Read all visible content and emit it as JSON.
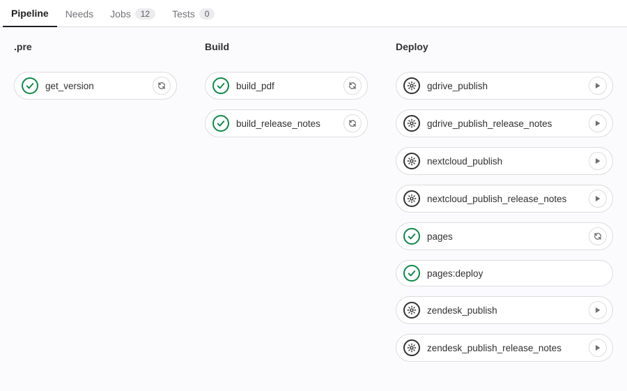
{
  "tabs": [
    {
      "label": "Pipeline",
      "badge": null,
      "active": true
    },
    {
      "label": "Needs",
      "badge": null,
      "active": false
    },
    {
      "label": "Jobs",
      "badge": "12",
      "active": false
    },
    {
      "label": "Tests",
      "badge": "0",
      "active": false
    }
  ],
  "stages": [
    {
      "title": ".pre",
      "wide": false,
      "jobs": [
        {
          "name": "get_version",
          "status": "passed",
          "action": "retry"
        }
      ]
    },
    {
      "title": "Build",
      "wide": false,
      "jobs": [
        {
          "name": "build_pdf",
          "status": "passed",
          "action": "retry"
        },
        {
          "name": "build_release_notes",
          "status": "passed",
          "action": "retry"
        }
      ]
    },
    {
      "title": "Deploy",
      "wide": true,
      "jobs": [
        {
          "name": "gdrive_publish",
          "status": "manual",
          "action": "play"
        },
        {
          "name": "gdrive_publish_release_notes",
          "status": "manual",
          "action": "play"
        },
        {
          "name": "nextcloud_publish",
          "status": "manual",
          "action": "play"
        },
        {
          "name": "nextcloud_publish_release_notes",
          "status": "manual",
          "action": "play"
        },
        {
          "name": "pages",
          "status": "passed",
          "action": "retry"
        },
        {
          "name": "pages:deploy",
          "status": "passed",
          "action": null
        },
        {
          "name": "zendesk_publish",
          "status": "manual",
          "action": "play"
        },
        {
          "name": "zendesk_publish_release_notes",
          "status": "manual",
          "action": "play"
        }
      ]
    }
  ]
}
